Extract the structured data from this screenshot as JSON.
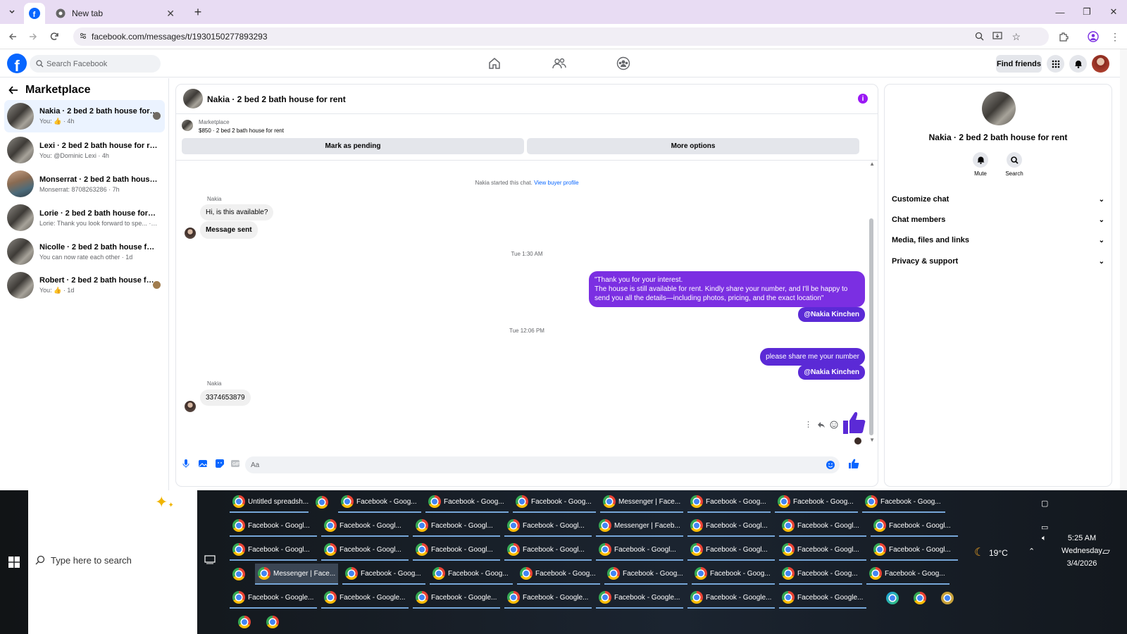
{
  "browser": {
    "tabs": [
      {
        "label": "",
        "icon": "facebook-icon"
      },
      {
        "label": "New tab",
        "icon": "chrome-icon"
      }
    ],
    "url": "facebook.com/messages/t/1930150277893293"
  },
  "facebook": {
    "search_placeholder": "Search Facebook",
    "find_friends": "Find friends"
  },
  "sidebar": {
    "title": "Marketplace",
    "conversations": [
      {
        "title": "Nakia · 2 bed 2 bath house for r...",
        "sub": "You: 👍 · 4h"
      },
      {
        "title": "Lexi · 2 bed 2 bath house for rent",
        "sub": "You: @Dominic Lexi · 4h"
      },
      {
        "title": "Monserrat · 2 bed 2 bath house fo...",
        "sub": "Monserrat: 8708263286 · 7h"
      },
      {
        "title": "Lorie · 2 bed 2 bath house for rent",
        "sub": "Lorie: Thank you look forward to spe... · 14h"
      },
      {
        "title": "Nicolle · 2 bed 2 bath house for rent",
        "sub": "You can now rate each other · 1d"
      },
      {
        "title": "Robert · 2 bed 2 bath house for ...",
        "sub": "You: 👍 · 1d"
      }
    ]
  },
  "chat": {
    "title": "Nakia · 2 bed 2 bath house for rent",
    "marketplace_label": "Marketplace",
    "listing": "$850 · 2 bed 2 bath house for rent",
    "mark_pending": "Mark as pending",
    "more_options": "More options",
    "started_note": "Nakia started this chat.",
    "view_profile": "View buyer profile",
    "sender_name": "Nakia",
    "msg_in_1": "Hi, is this available?",
    "msg_in_2": "Message sent",
    "time_1": "Tue 1:30 AM",
    "msg_out_1_l1": "\"Thank you for your interest.",
    "msg_out_1_l2": "The house is still available for rent. Kindly share your number, and I'll be happy to",
    "msg_out_1_l3": "send you all the details—including photos, pricing, and the exact location\"",
    "tag": "@Nakia Kinchen",
    "time_2": "Tue 12:06 PM",
    "msg_out_2": "please share me your number",
    "sender_name_2": "Nakia",
    "msg_in_3": "3374653879",
    "composer_placeholder": "Aa"
  },
  "details": {
    "title": "Nakia · 2 bed 2 bath house for rent",
    "mute": "Mute",
    "search": "Search",
    "sections": [
      "Customize chat",
      "Chat members",
      "Media, files and links",
      "Privacy & support"
    ]
  },
  "taskbar": {
    "search_placeholder": "Type here to search",
    "rows": [
      [
        "Untitled spreadsh...",
        "",
        "Facebook - Goog...",
        "Facebook - Goog...",
        "Facebook - Goog...",
        "Messenger | Face...",
        "Facebook - Goog...",
        "Facebook - Goog...",
        "Facebook - Goog..."
      ],
      [
        "Facebook - Googl...",
        "Facebook - Googl...",
        "Facebook - Googl...",
        "Facebook - Googl...",
        "Messenger | Faceb...",
        "Facebook - Googl...",
        "Facebook - Googl...",
        "Facebook - Googl..."
      ],
      [
        "Facebook - Googl...",
        "Facebook - Googl...",
        "Facebook - Googl...",
        "Facebook - Googl...",
        "Facebook - Googl...",
        "Facebook - Googl...",
        "Facebook - Googl...",
        "Facebook - Googl..."
      ],
      [
        "",
        "Messenger | Face...",
        "Facebook - Goog...",
        "Facebook - Goog...",
        "Facebook - Goog...",
        "Facebook - Goog...",
        "Facebook - Goog...",
        "Facebook - Goog...",
        "Facebook - Goog..."
      ],
      [
        "Facebook - Google...",
        "Facebook - Google...",
        "Facebook - Google...",
        "Facebook - Google...",
        "Facebook - Google...",
        "Facebook - Google...",
        "Facebook - Google..."
      ]
    ],
    "weather": "19°C",
    "time": "5:25 AM",
    "day": "Wednesday",
    "date": "3/4/2026"
  },
  "colors": {
    "accent": "#0866ff",
    "bubble_out": "#7b2fe2",
    "tab_bar": "#e8dcf3"
  }
}
